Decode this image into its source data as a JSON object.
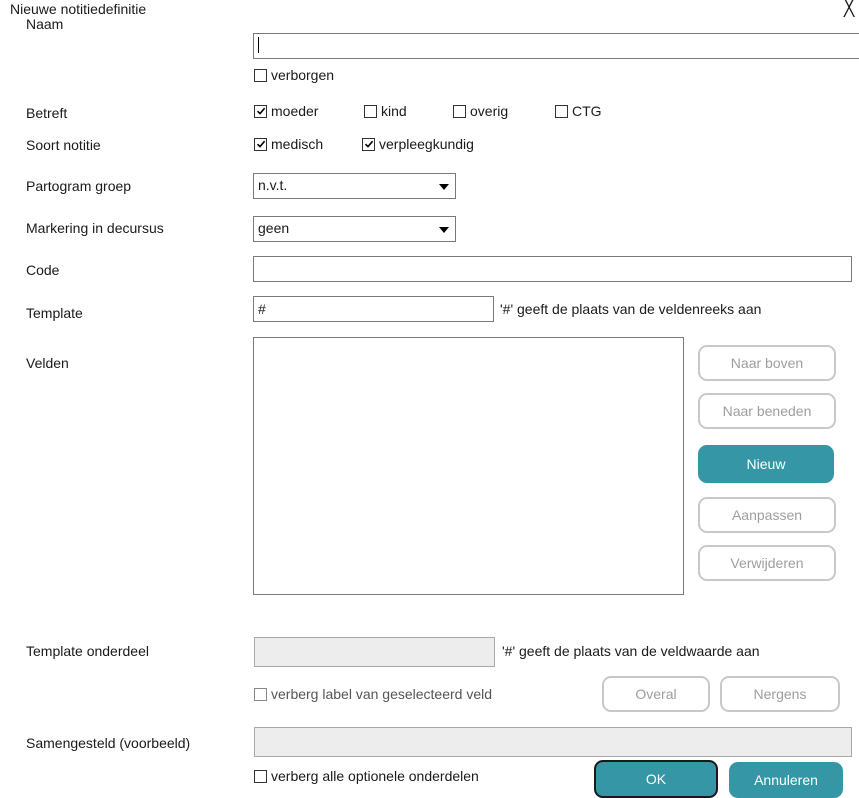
{
  "window": {
    "title": "Nieuwe notitiedefinitie",
    "close_glyph": "╳"
  },
  "naam": {
    "label": "Naam",
    "value": "",
    "hidden_checkbox": {
      "label": "verborgen",
      "checked": false
    }
  },
  "betreft": {
    "label": "Betreft",
    "options": [
      {
        "label": "moeder",
        "checked": true
      },
      {
        "label": "kind",
        "checked": false
      },
      {
        "label": "overig",
        "checked": false
      },
      {
        "label": "CTG",
        "checked": false
      }
    ]
  },
  "soort": {
    "label": "Soort notitie",
    "options": [
      {
        "label": "medisch",
        "checked": true
      },
      {
        "label": "verpleegkundig",
        "checked": true
      }
    ]
  },
  "partogram": {
    "label": "Partogram groep",
    "value": "n.v.t."
  },
  "markering": {
    "label": "Markering in decursus",
    "value": "geen"
  },
  "code": {
    "label": "Code",
    "value": ""
  },
  "template": {
    "label": "Template",
    "value": "#",
    "hint": "'#' geeft de plaats van de veldenreeks aan"
  },
  "velden": {
    "label": "Velden",
    "buttons": {
      "up": "Naar boven",
      "down": "Naar beneden",
      "new": "Nieuw",
      "edit": "Aanpassen",
      "delete": "Verwijderen"
    }
  },
  "template_onderdeel": {
    "label": "Template onderdeel",
    "value": "",
    "hint": "'#' geeft de plaats van de veldwaarde aan",
    "hide_label_checkbox": {
      "label": "verberg label van geselecteerd veld",
      "checked": false
    },
    "overal": "Overal",
    "nergens": "Nergens"
  },
  "samengesteld": {
    "label": "Samengesteld (voorbeeld)",
    "value": "",
    "hide_optional_checkbox": {
      "label": "verberg alle optionele onderdelen",
      "checked": false
    }
  },
  "footer": {
    "ok": "OK",
    "cancel": "Annuleren"
  },
  "colors": {
    "accent": "#3596a6",
    "disabled_text": "#9e9e9e"
  }
}
